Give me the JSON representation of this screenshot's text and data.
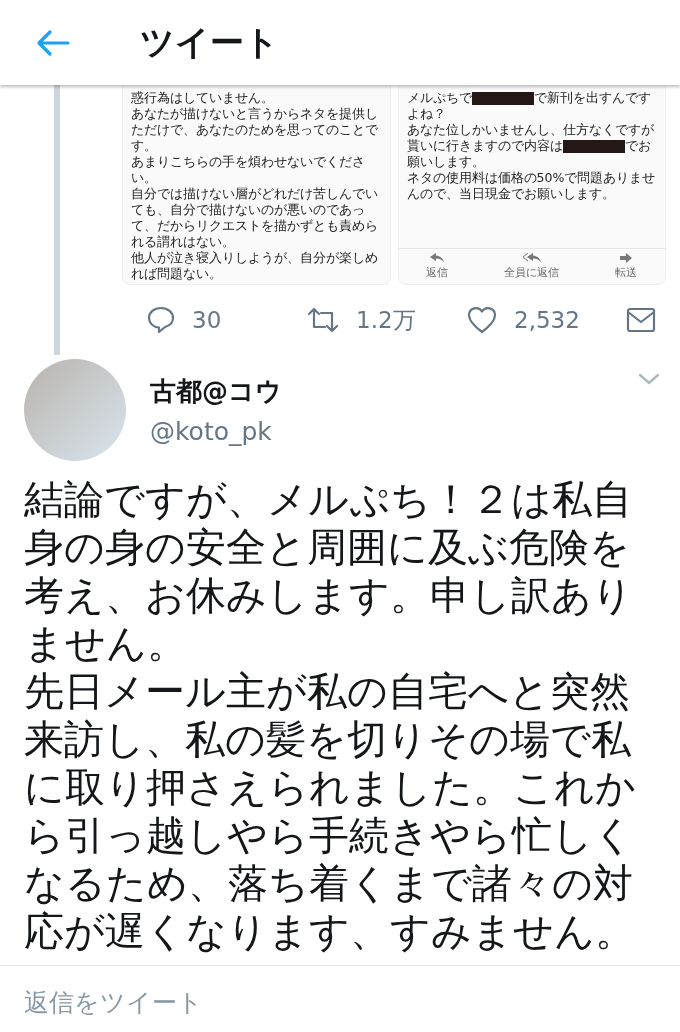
{
  "header": {
    "title": "ツイート"
  },
  "quoted_images": [
    {
      "lines": [
        [
          {
            "kind": "text",
            "text": "惑行為はしていません。"
          }
        ],
        [
          {
            "kind": "text",
            "text": "あなたが描けないと言うからネタを提供しただけで、あなたのためを思ってのことです。"
          }
        ],
        [
          {
            "kind": "text",
            "text": "あまりこちらの手を煩わせないでください。"
          }
        ],
        [
          {
            "kind": "text",
            "text": "自分では描けない層がどれだけ苦しんでいても、自分で描けないのが悪いのであって、だからリクエストを描かずとも責められる謂れはない。"
          }
        ],
        [
          {
            "kind": "text",
            "text": "他人が泣き寝入りしようが、自分が楽しめれば問題ない。"
          }
        ]
      ]
    },
    {
      "lines": [
        [
          {
            "kind": "text",
            "text": "メルぷちで"
          },
          {
            "kind": "redacted"
          },
          {
            "kind": "text",
            "text": "で新刊を出すんですよね？"
          }
        ],
        [
          {
            "kind": "text",
            "text": "あなた位しかいませんし、仕方なくですが貰いに行きますので内容は"
          },
          {
            "kind": "redacted"
          },
          {
            "kind": "text",
            "text": "でお願いします。"
          }
        ],
        [
          {
            "kind": "text",
            "text": "ネタの使用料は価格の50%で問題ありませんので、当日現金でお願いします。"
          }
        ]
      ],
      "actions": [
        {
          "kind": "reply",
          "label": "返信"
        },
        {
          "kind": "reply_all",
          "label": "全員に返信"
        },
        {
          "kind": "forward",
          "label": "転送"
        }
      ]
    }
  ],
  "tweet_actions": [
    {
      "kind": "reply",
      "count": "30"
    },
    {
      "kind": "retweet",
      "count": "1.2万"
    },
    {
      "kind": "like",
      "count": "2,532"
    },
    {
      "kind": "dm"
    }
  ],
  "author": {
    "name": "古都@コウ",
    "handle": "@koto_pk"
  },
  "body": [
    "結論ですが、メルぷち！２は私自身の身の安全と周囲に及ぶ危険を考え、お休みします。申し訳ありません。",
    "先日メール主が私の自宅へと突然来訪し、私の髪を切りその場で私に取り押さえられました。これから引っ越しやら手続きやら忙しくなるため、落ち着くまで諸々の対応が遅くなります、すみません。"
  ],
  "reply_field": {
    "placeholder": "返信をツイート"
  }
}
